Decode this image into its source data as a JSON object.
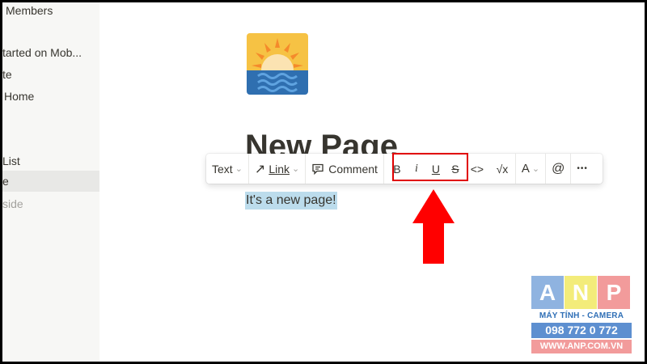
{
  "sidebar": {
    "items": [
      {
        "label": "Members",
        "style": "normal"
      },
      {
        "label": "tarted on Mob...",
        "style": "normal"
      },
      {
        "label": "te",
        "style": "normal"
      },
      {
        "label": "Home",
        "style": "normal"
      },
      {
        "label": "List",
        "style": "normal"
      },
      {
        "label": "e",
        "style": "active"
      },
      {
        "label": "side",
        "style": "gray"
      }
    ]
  },
  "page": {
    "icon": "sunrise-over-water-icon",
    "title": "New Page",
    "body_text": "It's a new page!"
  },
  "toolbar": {
    "text_label": "Text",
    "link_label": "Link",
    "comment_label": "Comment",
    "bold": "B",
    "italic": "i",
    "underline": "U",
    "strike": "S",
    "code": "<>",
    "math": "√x",
    "color": "A",
    "mention": "@",
    "more": "•••"
  },
  "annotation": {
    "box_color": "#e00000",
    "arrow_color": "#ff0000"
  },
  "watermark": {
    "letters": [
      "A",
      "N",
      "P"
    ],
    "tagline": "MÁY TÍNH - CAMERA",
    "phone": "098 772 0 772",
    "website": "WWW.ANP.COM.VN"
  }
}
